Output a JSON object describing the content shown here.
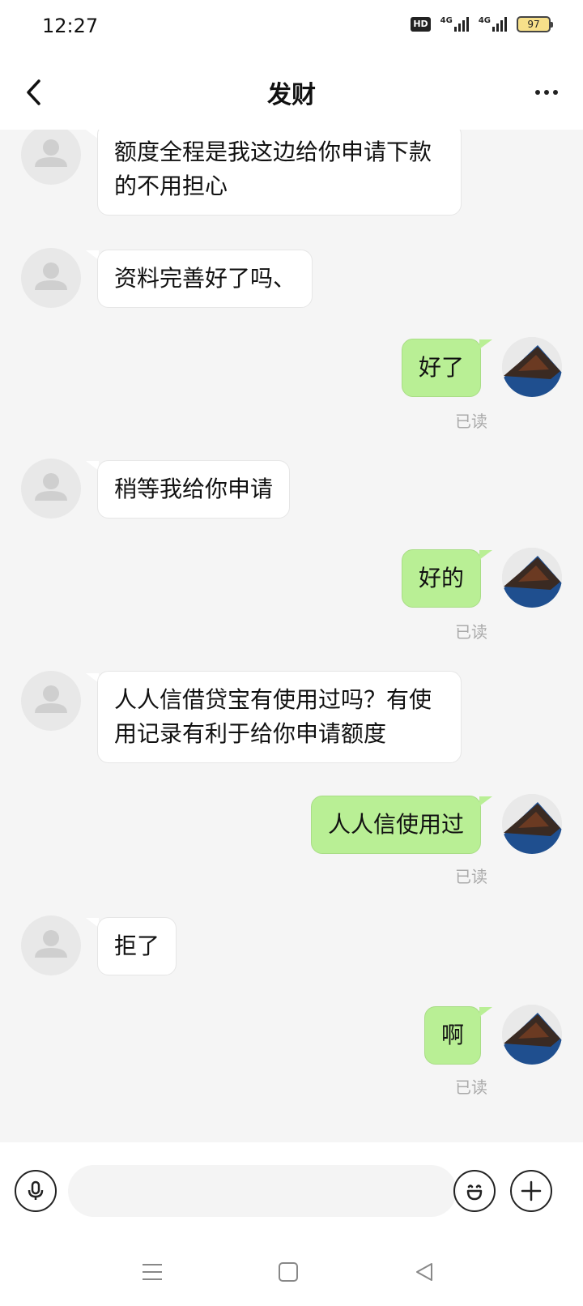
{
  "status_bar": {
    "time": "12:27",
    "hd_badge": "HD",
    "network_1": "4G",
    "network_2": "4G",
    "battery": "97"
  },
  "header": {
    "title": "发财"
  },
  "messages": [
    {
      "direction": "in",
      "text": "额度全程是我这边给你申请下款的不用担心"
    },
    {
      "direction": "in",
      "text": "资料完善好了吗、"
    },
    {
      "direction": "out",
      "text": "好了",
      "status": "已读"
    },
    {
      "direction": "in",
      "text": "稍等我给你申请"
    },
    {
      "direction": "out",
      "text": "好的",
      "status": "已读"
    },
    {
      "direction": "in",
      "text": "人人信借贷宝有使用过吗？有使用记录有利于给你申请额度"
    },
    {
      "direction": "out",
      "text": "人人信使用过",
      "status": "已读"
    },
    {
      "direction": "in",
      "text": "拒了"
    },
    {
      "direction": "out",
      "text": "啊",
      "status": "已读"
    }
  ],
  "input": {
    "value": "",
    "placeholder": ""
  },
  "colors": {
    "outgoing_bubble": "#b9ef95",
    "incoming_bubble": "#ffffff",
    "background": "#f5f5f5"
  }
}
